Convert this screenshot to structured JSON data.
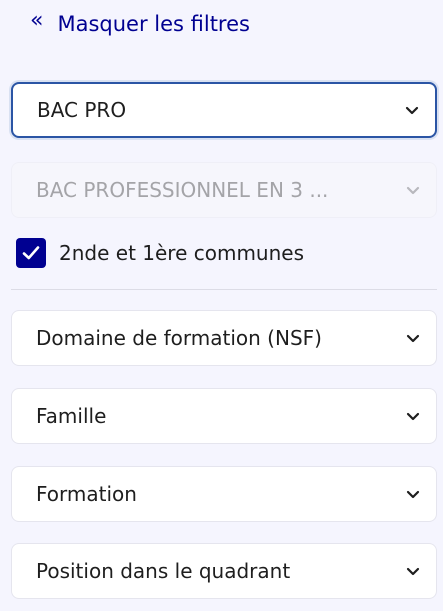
{
  "header": {
    "toggle_icon": "double-chevron-left-icon",
    "toggle_label": "Masquer les filtres"
  },
  "filters": {
    "diplome": {
      "value": "BAC PRO",
      "state": "focused"
    },
    "specialite": {
      "value": "BAC PROFESSIONNEL EN 3 ...",
      "state": "disabled"
    },
    "seconde_commune": {
      "label": "2nde et 1ère communes",
      "checked": true
    },
    "domaine": {
      "value": "Domaine de formation (NSF)"
    },
    "famille": {
      "value": "Famille"
    },
    "formation": {
      "value": "Formation"
    },
    "position": {
      "value": "Position dans le quadrant"
    }
  },
  "colors": {
    "accent": "#000091",
    "background": "#f5f5fe",
    "focus_border": "#2b55a5",
    "disabled_text": "#a4a4a8"
  }
}
